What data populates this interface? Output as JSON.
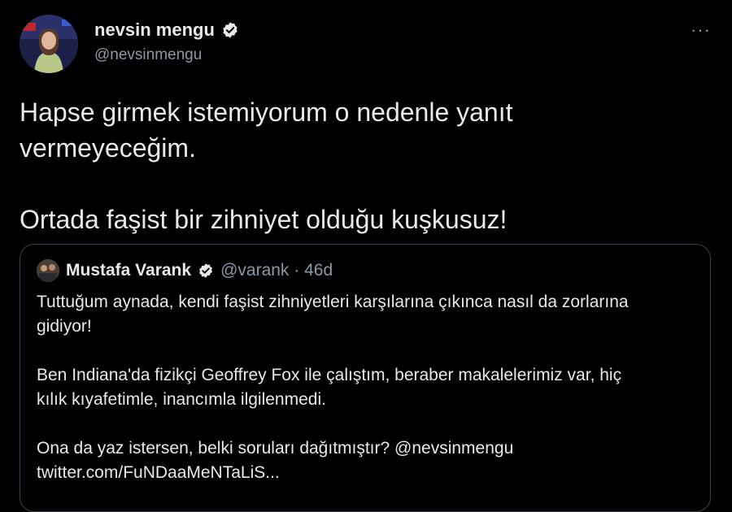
{
  "author": {
    "display_name": "nevsin mengu",
    "handle": "@nevsinmengu",
    "verified_icon": "verified-badge-icon"
  },
  "more_menu_icon": "more-options-icon",
  "tweet": {
    "line1": "Hapse girmek istemiyorum o nedenle yanıt",
    "line2": "vermeyeceğim.",
    "line3": "Ortada faşist bir zihniyet olduğu kuşkusuz!"
  },
  "quoted_tweet": {
    "display_name": "Mustafa Varank",
    "handle_and_time": "@varank · 46d",
    "line1": "Tuttuğum aynada, kendi faşist zihniyetleri karşılarına  çıkınca nasıl da zorlarına",
    "line2": "gidiyor!",
    "line3": "Ben Indiana'da fizikçi Geoffrey Fox ile çalıştım, beraber makalelerimiz var, hiç",
    "line4": "kılık kıyafetimle, inancımla ilgilenmedi.",
    "line5": "Ona da yaz istersen, belki soruları dağıtmıştır? @nevsinmengu",
    "line6": "twitter.com/FuNDaaMeNTaLiS..."
  },
  "colors": {
    "background": "#000000",
    "text": "#e7e9ea",
    "secondary": "#8b98a5",
    "verified": "#e7e9ea",
    "border": "#3b4148"
  }
}
